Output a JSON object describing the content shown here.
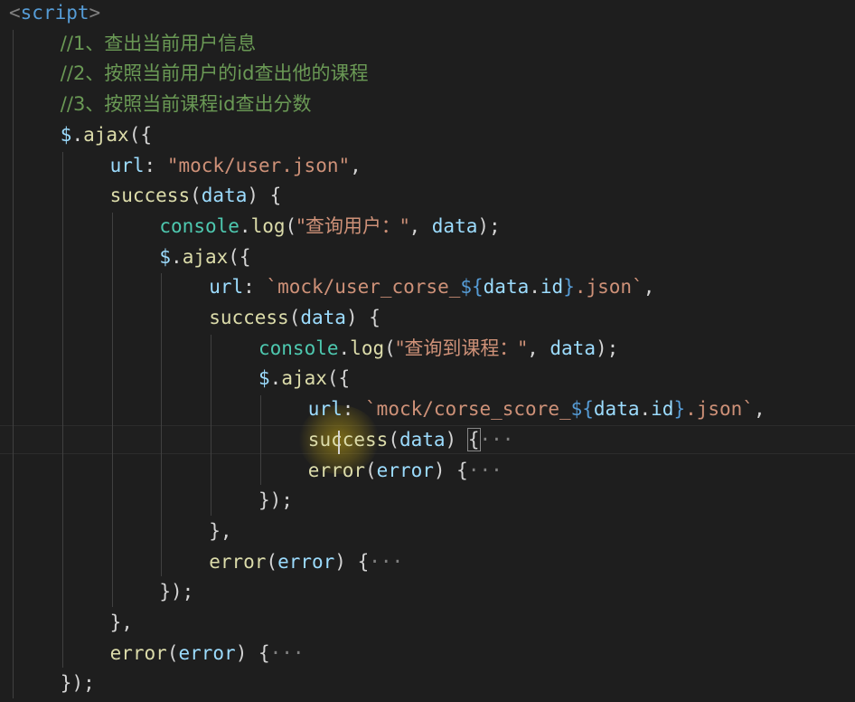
{
  "editor": {
    "lines": [
      [
        {
          "t": "<",
          "c": "tag"
        },
        {
          "t": "script",
          "c": "tagname"
        },
        {
          "t": ">",
          "c": "tag"
        }
      ],
      [
        {
          "t": "//1、查出当前用户信息",
          "c": "comment"
        }
      ],
      [
        {
          "t": "//2、按照当前用户的id查出他的课程",
          "c": "comment"
        }
      ],
      [
        {
          "t": "//3、按照当前课程id查出分数",
          "c": "comment"
        }
      ],
      [
        {
          "t": "$",
          "c": "var"
        },
        {
          "t": ".",
          "c": "punct"
        },
        {
          "t": "ajax",
          "c": "fn"
        },
        {
          "t": "({",
          "c": "punct"
        }
      ],
      [
        {
          "t": "url",
          "c": "var"
        },
        {
          "t": ": ",
          "c": "punct"
        },
        {
          "t": "\"mock/user.json\"",
          "c": "str"
        },
        {
          "t": ",",
          "c": "punct"
        }
      ],
      [
        {
          "t": "success",
          "c": "fn"
        },
        {
          "t": "(",
          "c": "punct"
        },
        {
          "t": "data",
          "c": "param"
        },
        {
          "t": ") {",
          "c": "punct"
        }
      ],
      [
        {
          "t": "console",
          "c": "obj"
        },
        {
          "t": ".",
          "c": "punct"
        },
        {
          "t": "log",
          "c": "fn"
        },
        {
          "t": "(",
          "c": "punct"
        },
        {
          "t": "\"查询用户：\"",
          "c": "str"
        },
        {
          "t": ", ",
          "c": "punct"
        },
        {
          "t": "data",
          "c": "param"
        },
        {
          "t": ");",
          "c": "punct"
        }
      ],
      [
        {
          "t": "$",
          "c": "var"
        },
        {
          "t": ".",
          "c": "punct"
        },
        {
          "t": "ajax",
          "c": "fn"
        },
        {
          "t": "({",
          "c": "punct"
        }
      ],
      [
        {
          "t": "url",
          "c": "var"
        },
        {
          "t": ": ",
          "c": "punct"
        },
        {
          "t": "`mock/user_corse_",
          "c": "str"
        },
        {
          "t": "${",
          "c": "tpl"
        },
        {
          "t": "data",
          "c": "param"
        },
        {
          "t": ".",
          "c": "punct"
        },
        {
          "t": "id",
          "c": "param"
        },
        {
          "t": "}",
          "c": "tpl"
        },
        {
          "t": ".json`",
          "c": "str"
        },
        {
          "t": ",",
          "c": "punct"
        }
      ],
      [
        {
          "t": "success",
          "c": "fn"
        },
        {
          "t": "(",
          "c": "punct"
        },
        {
          "t": "data",
          "c": "param"
        },
        {
          "t": ") {",
          "c": "punct"
        }
      ],
      [
        {
          "t": "console",
          "c": "obj"
        },
        {
          "t": ".",
          "c": "punct"
        },
        {
          "t": "log",
          "c": "fn"
        },
        {
          "t": "(",
          "c": "punct"
        },
        {
          "t": "\"查询到课程：\"",
          "c": "str"
        },
        {
          "t": ", ",
          "c": "punct"
        },
        {
          "t": "data",
          "c": "param"
        },
        {
          "t": ");",
          "c": "punct"
        }
      ],
      [
        {
          "t": "$",
          "c": "var"
        },
        {
          "t": ".",
          "c": "punct"
        },
        {
          "t": "ajax",
          "c": "fn"
        },
        {
          "t": "({",
          "c": "punct"
        }
      ],
      [
        {
          "t": "url",
          "c": "var"
        },
        {
          "t": ": ",
          "c": "punct"
        },
        {
          "t": "`mock/corse_score_",
          "c": "str"
        },
        {
          "t": "${",
          "c": "tpl"
        },
        {
          "t": "data",
          "c": "param"
        },
        {
          "t": ".",
          "c": "punct"
        },
        {
          "t": "id",
          "c": "param"
        },
        {
          "t": "}",
          "c": "tpl"
        },
        {
          "t": ".json`",
          "c": "str"
        },
        {
          "t": ",",
          "c": "punct"
        }
      ],
      [
        {
          "t": "success",
          "c": "fn"
        },
        {
          "t": "(",
          "c": "punct"
        },
        {
          "t": "data",
          "c": "param"
        },
        {
          "t": ") ",
          "c": "punct"
        },
        {
          "t": "{",
          "c": "punct",
          "cursor": true
        },
        {
          "t": "···",
          "c": "ellipsis"
        }
      ],
      [
        {
          "t": "error",
          "c": "fn"
        },
        {
          "t": "(",
          "c": "punct"
        },
        {
          "t": "error",
          "c": "param"
        },
        {
          "t": ") {",
          "c": "punct"
        },
        {
          "t": "···",
          "c": "ellipsis"
        }
      ],
      [
        {
          "t": "});",
          "c": "punct"
        }
      ],
      [
        {
          "t": "},",
          "c": "punct"
        }
      ],
      [
        {
          "t": "error",
          "c": "fn"
        },
        {
          "t": "(",
          "c": "punct"
        },
        {
          "t": "error",
          "c": "param"
        },
        {
          "t": ") {",
          "c": "punct"
        },
        {
          "t": "···",
          "c": "ellipsis"
        }
      ],
      [
        {
          "t": "});",
          "c": "punct"
        }
      ],
      [
        {
          "t": "},",
          "c": "punct"
        }
      ],
      [
        {
          "t": "error",
          "c": "fn"
        },
        {
          "t": "(",
          "c": "punct"
        },
        {
          "t": "error",
          "c": "param"
        },
        {
          "t": ") {",
          "c": "punct"
        },
        {
          "t": "···",
          "c": "ellipsis"
        }
      ],
      [
        {
          "t": "});",
          "c": "punct"
        }
      ]
    ],
    "indent_levels": [
      0,
      1,
      1,
      1,
      1,
      2,
      2,
      3,
      3,
      4,
      4,
      5,
      5,
      6,
      6,
      6,
      5,
      4,
      4,
      3,
      2,
      2,
      1
    ],
    "colors": {
      "background": "#1e1e1e",
      "comment": "#6a9955",
      "keyword": "#569cd6",
      "function": "#dcdcaa",
      "string": "#ce9178",
      "variable": "#9cdcfe",
      "object": "#4ec9b0"
    }
  }
}
